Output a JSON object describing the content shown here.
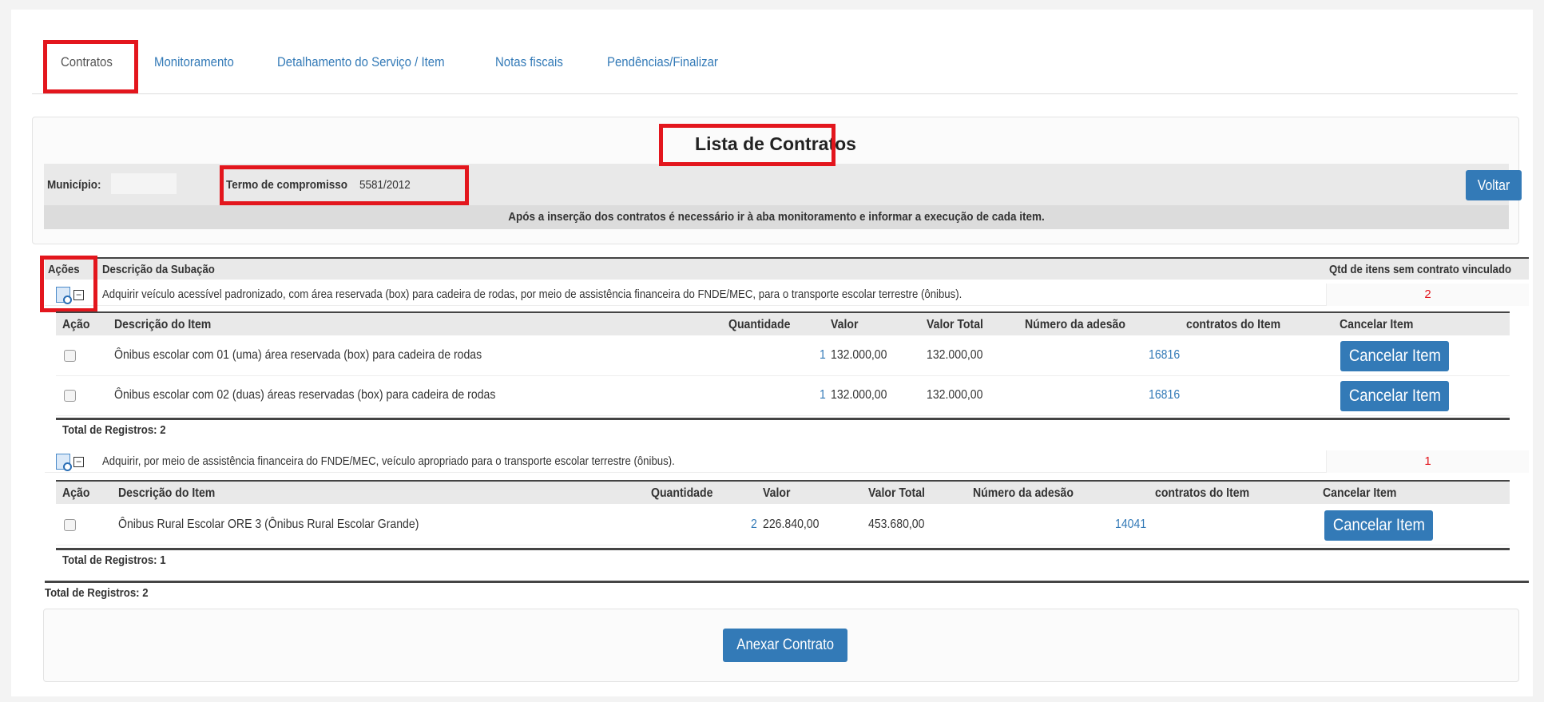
{
  "tabs": [
    "Contratos",
    "Monitoramento",
    "Detalhamento do Serviço / Item",
    "Notas fiscais",
    "Pendências/Finalizar"
  ],
  "panel": {
    "title": "Lista de Contratos",
    "municipio_label": "Município:",
    "termo_label": "Termo de compromisso",
    "termo_value": "5581/2012",
    "voltar_label": "Voltar",
    "note": "Após a inserção dos contratos é necessário ir à aba monitoramento e informar a execução de cada item."
  },
  "grid": {
    "headers": {
      "acoes": "Ações",
      "descricao": "Descrição da Subação",
      "qtd": "Qtd de itens sem contrato vinculado"
    },
    "subacoes": [
      {
        "descricao": "Adquirir veículo acessível padronizado, com área reservada (box) para cadeira de rodas, por meio de assistência financeira do FNDE/MEC, para o transporte escolar terrestre (ônibus).",
        "qtd": "2",
        "items_headers": {
          "acao": "Ação",
          "descricao": "Descrição do Item",
          "quantidade": "Quantidade",
          "valor": "Valor",
          "valor_total": "Valor Total",
          "numero_adesao": "Número da adesão",
          "contratos": "contratos do Item",
          "cancelar": "Cancelar Item"
        },
        "items": [
          {
            "descricao": "Ônibus escolar com 01 (uma) área reservada (box) para cadeira de rodas",
            "quantidade": "1",
            "valor": "132.000,00",
            "valor_total": "132.000,00",
            "numero_adesao": "16816",
            "cancelar": "Cancelar Item"
          },
          {
            "descricao": "Ônibus escolar com 02 (duas) áreas reservadas (box) para cadeira de rodas",
            "quantidade": "1",
            "valor": "132.000,00",
            "valor_total": "132.000,00",
            "numero_adesao": "16816",
            "cancelar": "Cancelar Item"
          }
        ],
        "total": "Total de Registros: 2"
      },
      {
        "descricao": "Adquirir, por meio de assistência financeira do FNDE/MEC, veículo apropriado para o transporte escolar terrestre (ônibus).",
        "qtd": "1",
        "items_headers": {
          "acao": "Ação",
          "descricao": "Descrição do Item",
          "quantidade": "Quantidade",
          "valor": "Valor",
          "valor_total": "Valor Total",
          "numero_adesao": "Número da adesão",
          "contratos": "contratos do Item",
          "cancelar": "Cancelar Item"
        },
        "items": [
          {
            "descricao": "Ônibus Rural Escolar ORE 3 (Ônibus Rural Escolar Grande)",
            "quantidade": "2",
            "valor": "226.840,00",
            "valor_total": "453.680,00",
            "numero_adesao": "14041",
            "cancelar": "Cancelar Item"
          }
        ],
        "total": "Total de Registros: 1"
      }
    ],
    "total": "Total de Registros: 2"
  },
  "footer": {
    "anexar_label": "Anexar Contrato"
  },
  "colors": {
    "accent": "#337ab7",
    "highlight": "#e3161d",
    "qtd_text": "#e3161d"
  }
}
